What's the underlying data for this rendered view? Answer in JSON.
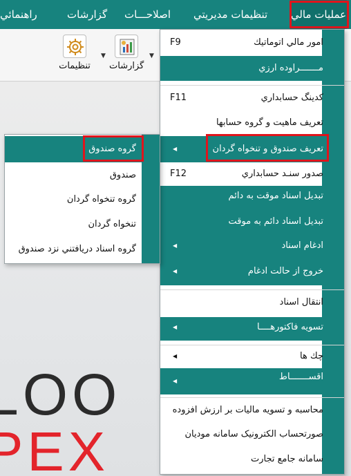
{
  "menubar": {
    "items": [
      "عمليات مالي",
      "تنظيمات مديريتي",
      "اصلاحـــات",
      "گزارشات",
      "راهنمائي"
    ]
  },
  "toolbar": {
    "reports_label": "گزارشات",
    "settings_label": "تنظيمات"
  },
  "logo": {
    "line1": "LOO",
    "line2": "PEX"
  },
  "main_menu": {
    "items": [
      {
        "label": "امور مالي اتوماتيك",
        "shortcut": "F9"
      },
      {
        "label": "مـــــــراوده ارزي"
      },
      {
        "label": "كدينگ حسابداري",
        "shortcut": "F11"
      },
      {
        "label": "تعريف ماهيت و گروه حسابها"
      },
      {
        "label": "تعريف صندوق و تنخواه گردان"
      },
      {
        "label": "صدور سنـد حسابداري",
        "shortcut": "F12"
      },
      {
        "label": "تبديل اسناد موقت به دائم"
      },
      {
        "label": "تبديل اسناد دائم به موقت"
      },
      {
        "label": "ادغام اسناد"
      },
      {
        "label": "خروج از حالت ادغام"
      },
      {
        "label": "انتقال اسناد"
      },
      {
        "label": "تسويه فاكتورهــــا"
      },
      {
        "label": "چك ها"
      },
      {
        "label": "اقســـــــاط"
      },
      {
        "label": "محاسبه و تسويه ماليات بر ارزش افزوده"
      },
      {
        "label": "صورتحساب الكترونيک سامانه موديان"
      },
      {
        "label": "سامانه جامع تجارت"
      }
    ]
  },
  "submenu": {
    "items": [
      "گروه صندوق",
      "صندوق",
      "گروه تنخواه گردان",
      "تنخواه گردان",
      "گروه اسناد دريافتني نزد صندوق"
    ]
  },
  "colors": {
    "teal": "#17837e",
    "highlight_border": "#e0141c",
    "logo_red": "#e3242b"
  },
  "icons": [
    "report-chart-icon",
    "gear-icon",
    "submenu-arrow-icon",
    "dropdown-arrow-icon"
  ]
}
